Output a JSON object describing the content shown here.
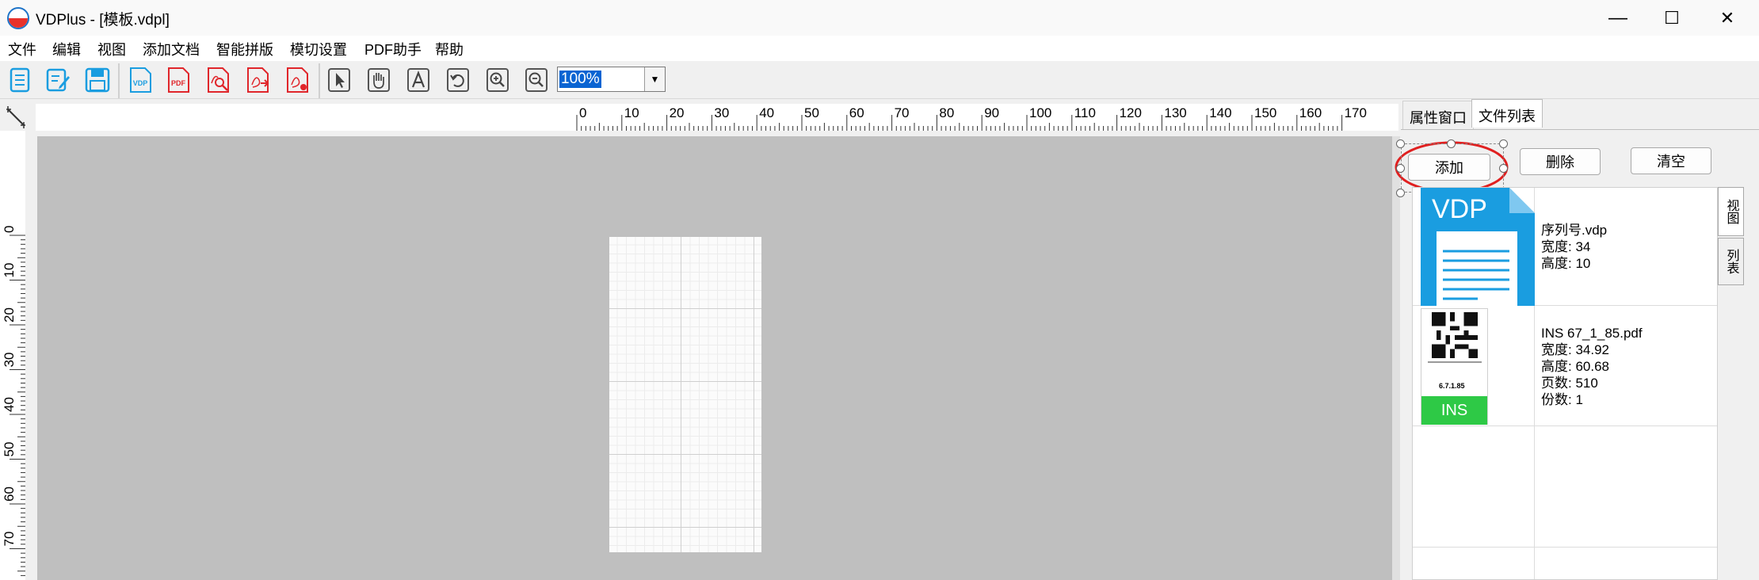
{
  "window": {
    "title": "VDPlus - [模板.vdpl]",
    "minimize": "—",
    "maximize": "☐",
    "close": "✕"
  },
  "menu": [
    "文件",
    "编辑",
    "视图",
    "添加文档",
    "智能拼版",
    "模切设置",
    "PDF助手",
    "帮助"
  ],
  "toolbar": {
    "icons": [
      "new-doc-icon",
      "edit-doc-icon",
      "save-icon",
      "vdp-icon",
      "pdf-icon",
      "pdf-search-icon",
      "pdf-export-icon",
      "pdf-settings-icon",
      "select-pointer-icon",
      "hand-pan-icon",
      "text-tool-icon",
      "rotate-icon",
      "zoom-in-icon",
      "zoom-out-icon"
    ],
    "vdp_label": "VDP",
    "pdf_label": "PDF",
    "zoom": "100%"
  },
  "ruler": {
    "h_ticks": [
      "0",
      "10",
      "20",
      "30",
      "40",
      "50",
      "60",
      "70",
      "80",
      "90",
      "100",
      "110",
      "120",
      "130",
      "140",
      "150",
      "160",
      "170"
    ],
    "v_ticks": [
      "0",
      "10",
      "20",
      "30",
      "40",
      "50",
      "60",
      "70"
    ]
  },
  "panel": {
    "tabs": [
      "属性窗口",
      "文件列表"
    ],
    "buttons": {
      "add": "添加",
      "delete": "删除",
      "clear": "清空"
    },
    "side_tabs": [
      "视图",
      "列表"
    ],
    "files": [
      {
        "thumb_label": "VDP",
        "name": "序列号.vdp",
        "lines": [
          "宽度: 34",
          "高度: 10"
        ]
      },
      {
        "thumb_label": "INS",
        "thumb_code": "6.7.1.85",
        "name": "INS 67_1_85.pdf",
        "lines": [
          "宽度: 34.92",
          "高度: 60.68",
          "页数: 510",
          "份数: 1"
        ]
      }
    ]
  },
  "colors": {
    "accent": "#1a9de0",
    "pdf_red": "#e0262b",
    "ins_green": "#2ec946",
    "highlight": "#e02020"
  }
}
